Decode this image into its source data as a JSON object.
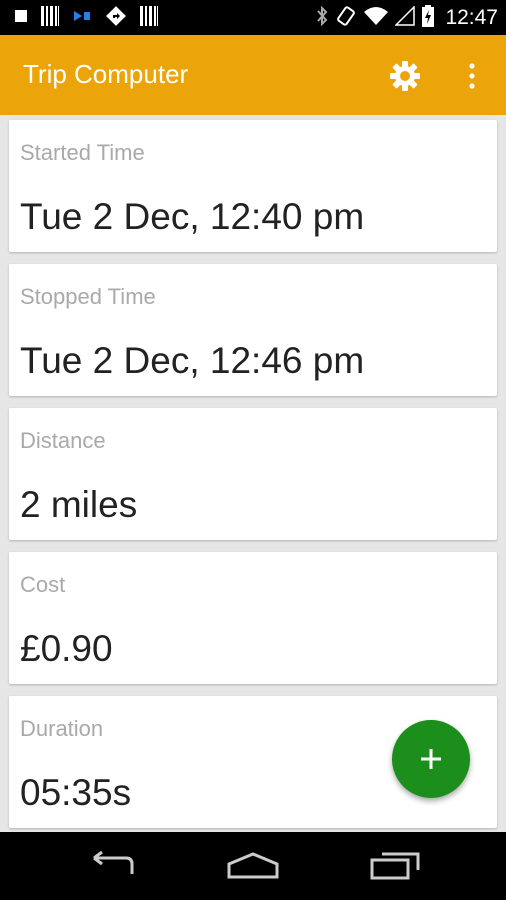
{
  "status_bar": {
    "time": "12:47",
    "left_icons": [
      "stop-icon",
      "barcode-icon",
      "cast-icon",
      "directions-icon",
      "barcode-icon"
    ],
    "right_icons": [
      "bluetooth-icon",
      "rotate-icon",
      "wifi-icon",
      "signal-icon",
      "battery-charging-icon"
    ]
  },
  "app_bar": {
    "title": "Trip Computer",
    "background": "#eca40b",
    "actions": [
      "settings-gear-icon",
      "more-vert-icon"
    ]
  },
  "cards": [
    {
      "label": "Started Time",
      "value": "Tue 2 Dec, 12:40 pm"
    },
    {
      "label": "Stopped Time",
      "value": "Tue 2 Dec, 12:46 pm"
    },
    {
      "label": "Distance",
      "value": "2 miles"
    },
    {
      "label": "Cost",
      "value": "£0.90"
    },
    {
      "label": "Duration",
      "value": "05:35s"
    }
  ],
  "fab": {
    "icon": "add-icon",
    "color": "#1c8e1c"
  },
  "nav_bar": {
    "buttons": [
      "back-icon",
      "home-icon",
      "recents-icon"
    ]
  }
}
